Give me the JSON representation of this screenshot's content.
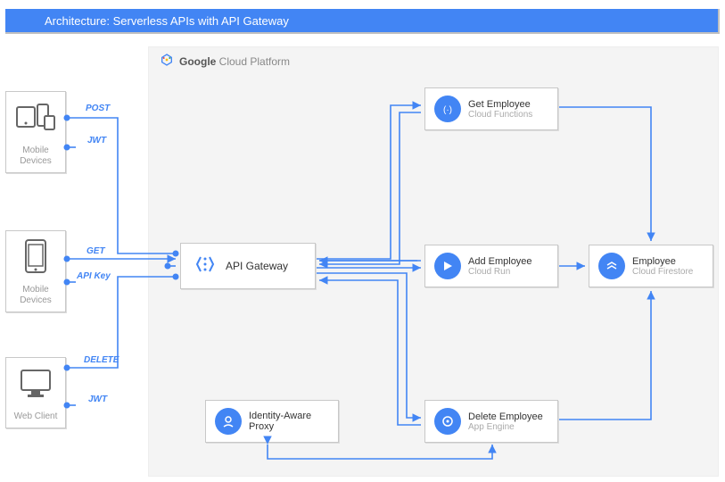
{
  "title": "Architecture: Serverless APIs with API Gateway",
  "platform": {
    "brand_bold": "Google",
    "brand_rest": " Cloud Platform"
  },
  "clients": {
    "c1": {
      "label": "Mobile Devices"
    },
    "c2": {
      "label": "Mobile Devices"
    },
    "c3": {
      "label": "Web Client"
    }
  },
  "edges": {
    "e1_verb": "POST",
    "e1_auth": "JWT",
    "e2_verb": "GET",
    "e2_auth": "API Key",
    "e3_verb": "DELETE",
    "e3_auth": "JWT"
  },
  "services": {
    "apigw": {
      "name": "API Gateway"
    },
    "getemp": {
      "name": "Get Employee",
      "sub": "Cloud Functions"
    },
    "addemp": {
      "name": "Add Employee",
      "sub": "Cloud Run"
    },
    "delemp": {
      "name": "Delete Employee",
      "sub": "App Engine"
    },
    "iap": {
      "name": "Identity-Aware Proxy",
      "sub": ""
    },
    "store": {
      "name": "Employee",
      "sub": "Cloud Firestore"
    }
  }
}
